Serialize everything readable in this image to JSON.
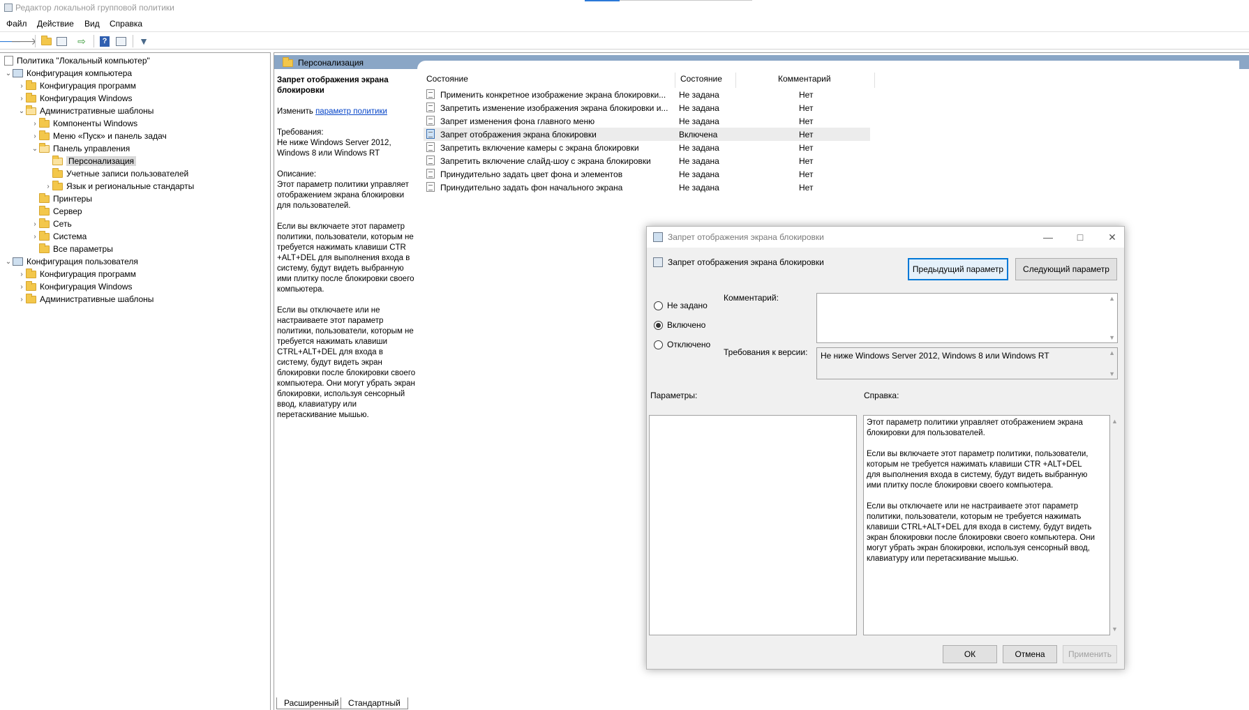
{
  "window": {
    "title": "Редактор локальной групповой политики"
  },
  "menu": [
    "Файл",
    "Действие",
    "Вид",
    "Справка"
  ],
  "toolbar": {
    "back_icon": "back-arrow-icon",
    "forward_icon": "forward-arrow-icon",
    "up_icon": "up-folder-icon",
    "show_hide_tree_icon": "console-tree-icon",
    "export_icon": "export-list-icon",
    "help_icon": "help-icon",
    "properties_icon": "properties-icon",
    "filter_icon": "filter-icon"
  },
  "tree": {
    "root": "Политика \"Локальный компьютер\"",
    "computer_config": "Конфигурация компьютера",
    "cc_programs": "Конфигурация программ",
    "cc_windows": "Конфигурация Windows",
    "cc_admin_templates": "Административные шаблоны",
    "windows_components": "Компоненты Windows",
    "start_menu": "Меню «Пуск» и панель задач",
    "control_panel": "Панель управления",
    "personalization": "Персонализация",
    "user_accounts": "Учетные записи пользователей",
    "region_language": "Язык и региональные стандарты",
    "printers": "Принтеры",
    "server": "Сервер",
    "network": "Сеть",
    "system": "Система",
    "all_settings": "Все параметры",
    "user_config": "Конфигурация пользователя",
    "uc_programs": "Конфигурация программ",
    "uc_windows": "Конфигурация Windows",
    "uc_admin_templates": "Административные шаблоны"
  },
  "content": {
    "header": "Персонализация",
    "description": {
      "title": "Запрет отображения экрана блокировки",
      "edit_prefix": "Изменить",
      "edit_link": "параметр политики",
      "requirements_label": "Требования:",
      "requirements": "Не ниже Windows Server 2012, Windows 8 или Windows RT",
      "description_label": "Описание:",
      "p1": "Этот параметр политики управляет отображением экрана блокировки для пользователей.",
      "p2": "Если вы включаете этот параметр политики, пользователи, которым не требуется нажимать клавиши CTR +ALT+DEL для выполнения входа в систему, будут видеть выбранную ими плитку после блокировки своего компьютера.",
      "p3": "Если вы отключаете или не настраиваете этот параметр политики, пользователи, которым не требуется нажимать клавиши CTRL+ALT+DEL для входа в систему, будут видеть экран блокировки после блокировки своего компьютера. Они могут убрать экран блокировки, используя сенсорный ввод, клавиатуру или перетаскивание мышью."
    },
    "columns": {
      "setting": "Состояние",
      "state": "Состояние",
      "comment": "Комментарий"
    },
    "rows": [
      {
        "name": "Применить конкретное изображение экрана блокировки...",
        "state": "Не задана",
        "comment": "Нет"
      },
      {
        "name": "Запретить изменение изображения экрана блокировки и...",
        "state": "Не задана",
        "comment": "Нет"
      },
      {
        "name": "Запрет изменения фона главного меню",
        "state": "Не задана",
        "comment": "Нет"
      },
      {
        "name": "Запрет отображения экрана блокировки",
        "state": "Включена",
        "comment": "Нет"
      },
      {
        "name": "Запретить включение камеры с экрана блокировки",
        "state": "Не задана",
        "comment": "Нет"
      },
      {
        "name": "Запретить включение слайд-шоу с экрана блокировки",
        "state": "Не задана",
        "comment": "Нет"
      },
      {
        "name": "Принудительно задать цвет фона и элементов",
        "state": "Не задана",
        "comment": "Нет"
      },
      {
        "name": "Принудительно задать фон начального экрана",
        "state": "Не задана",
        "comment": "Нет"
      }
    ],
    "tabs": {
      "extended": "Расширенный",
      "standard": "Стандартный"
    }
  },
  "dialog": {
    "title": "Запрет отображения экрана блокировки",
    "setting_name": "Запрет отображения экрана блокировки",
    "prev_button": "Предыдущий параметр",
    "next_button": "Следующий параметр",
    "radio_not_configured": "Не задано",
    "radio_enabled": "Включено",
    "radio_disabled": "Отключено",
    "selected": "Включено",
    "comment_label": "Комментарий:",
    "comment_value": "",
    "supported_label": "Требования к версии:",
    "supported_value": "Не ниже Windows Server 2012, Windows 8 или Windows RT",
    "options_label": "Параметры:",
    "help_label": "Справка:",
    "help_p1": "Этот параметр политики управляет отображением экрана блокировки для пользователей.",
    "help_p2": "Если вы включаете этот параметр политики, пользователи, которым не требуется нажимать клавиши CTR +ALT+DEL для выполнения входа в систему, будут видеть выбранную ими плитку после блокировки своего компьютера.",
    "help_p3": "Если вы отключаете или не настраиваете этот параметр политики, пользователи, которым не требуется нажимать клавиши CTRL+ALT+DEL для входа в систему, будут видеть экран блокировки после блокировки своего компьютера. Они могут убрать экран блокировки, используя сенсорный ввод, клавиатуру или перетаскивание мышью.",
    "ok": "ОК",
    "cancel": "Отмена",
    "apply": "Применить"
  },
  "colors": {
    "header_blue": "#8aa6c6",
    "focus_blue": "#0078d7",
    "link": "#0645c8",
    "folder": "#f3c74b"
  }
}
